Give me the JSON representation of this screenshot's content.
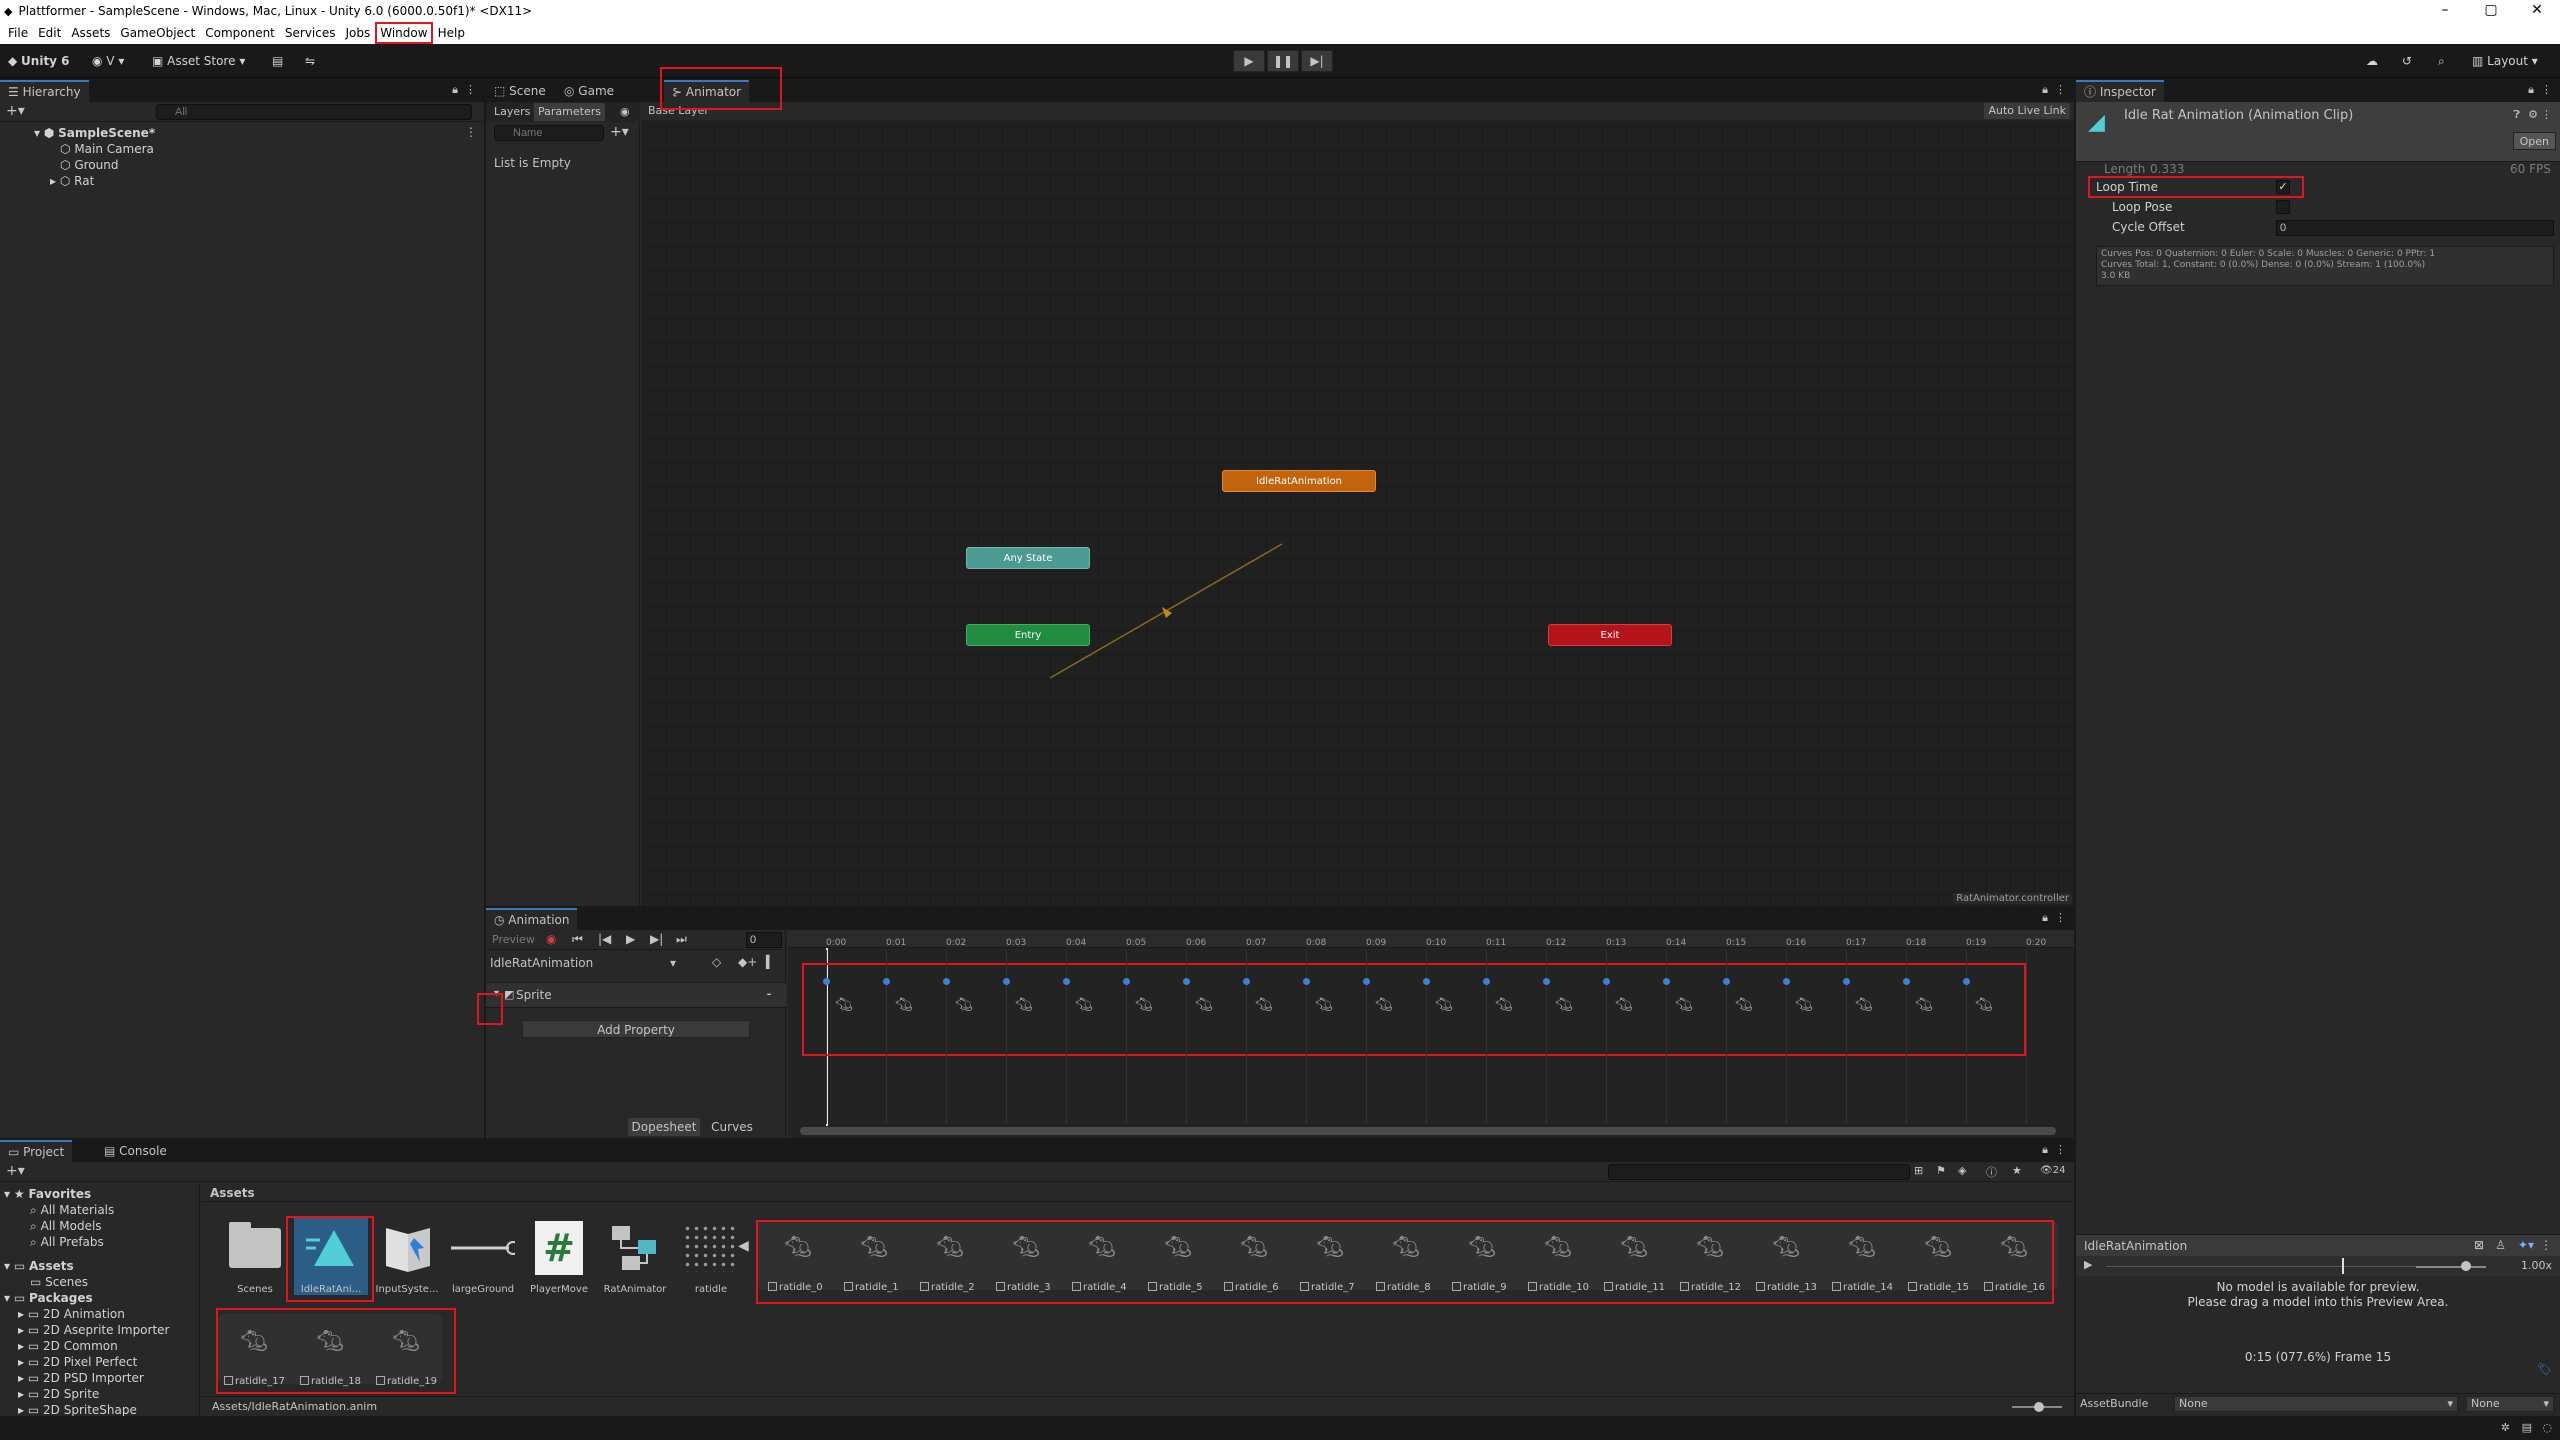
{
  "window": {
    "title": "Plattformer - SampleScene - Windows, Mac, Linux - Unity 6.0 (6000.0.50f1)* <DX11>",
    "controls": [
      "–",
      "▢",
      "✕"
    ]
  },
  "menu": [
    "File",
    "Edit",
    "Assets",
    "GameObject",
    "Component",
    "Services",
    "Jobs",
    "Window",
    "Help"
  ],
  "toolbar": {
    "account": "Unity 6",
    "version_btn": "V",
    "asset_store": "Asset Store",
    "layout": "Layout"
  },
  "hierarchy": {
    "tab": "Hierarchy",
    "search_placeholder": "All",
    "scene": "SampleScene*",
    "items": [
      "Main Camera",
      "Ground",
      "Rat"
    ]
  },
  "animator": {
    "tabs": [
      "Scene",
      "Game",
      "Animator"
    ],
    "layers_tab": "Layers",
    "parameters_tab": "Parameters",
    "name_placeholder": "Name",
    "list_empty": "List is Empty",
    "breadcrumb": "Base Layer",
    "auto_live_link": "Auto Live Link",
    "controller": "RatAnimator.controller",
    "states": {
      "idle": "IdleRatAnimation",
      "any": "Any State",
      "entry": "Entry",
      "exit": "Exit"
    }
  },
  "animation": {
    "tab": "Animation",
    "preview": "Preview",
    "frame": "0",
    "clip": "IdleRatAnimation",
    "property": "Sprite",
    "add_property": "Add Property",
    "dopesheet": "Dopesheet",
    "curves": "Curves",
    "ticks": [
      "0:00",
      "0:01",
      "0:02",
      "0:03",
      "0:04",
      "0:05",
      "0:06",
      "0:07",
      "0:08",
      "0:09",
      "0:10",
      "0:11",
      "0:12",
      "0:13",
      "0:14",
      "0:15",
      "0:16",
      "0:17",
      "0:18",
      "0:19",
      "0:20"
    ]
  },
  "inspector": {
    "tab": "Inspector",
    "title": "Idle Rat Animation (Animation Clip)",
    "open": "Open",
    "length_label": "Length",
    "length": "0.333",
    "fps": "60 FPS",
    "loop_time": "Loop Time",
    "loop_time_check": "✓",
    "loop_pose": "Loop Pose",
    "cycle_offset": "Cycle Offset",
    "cycle_offset_value": "0",
    "info1": "Curves Pos: 0 Quaternion: 0 Euler: 0 Scale: 0 Muscles: 0 Generic: 0 PPtr: 1",
    "info2": "Curves Total: 1, Constant: 0 (0.0%) Dense: 0 (0.0%) Stream: 1 (100.0%)",
    "info3": "3.0 KB",
    "preview_clip": "IdleRatAnimation",
    "speed": "1.00x",
    "no_model_1": "No model is available for preview.",
    "no_model_2": "Please drag a model into this Preview Area.",
    "time_readout": "0:15 (077.6%) Frame 15",
    "assetbundle_label": "AssetBundle",
    "assetbundle_value": "None",
    "variant_value": "None"
  },
  "project": {
    "tabs": [
      "Project",
      "Console"
    ],
    "favorites": "Favorites",
    "favorites_items": [
      "All Materials",
      "All Models",
      "All Prefabs"
    ],
    "assets": "Assets",
    "assets_items": [
      "Scenes"
    ],
    "packages": "Packages",
    "packages_items": [
      "2D Animation",
      "2D Aseprite Importer",
      "2D Common",
      "2D Pixel Perfect",
      "2D PSD Importer",
      "2D Sprite",
      "2D SpriteShape"
    ],
    "breadcrumb": "Assets",
    "count": "24",
    "footer_path": "Assets/IdleRatAnimation.anim",
    "files": [
      "Scenes",
      "IdleRatAni...",
      "InputSyste...",
      "largeGround",
      "PlayerMove",
      "RatAnimator",
      "ratidle"
    ],
    "sprites": [
      "ratidle_0",
      "ratidle_1",
      "ratidle_2",
      "ratidle_3",
      "ratidle_4",
      "ratidle_5",
      "ratidle_6",
      "ratidle_7",
      "ratidle_8",
      "ratidle_9",
      "ratidle_10",
      "ratidle_11",
      "ratidle_12",
      "ratidle_13",
      "ratidle_14",
      "ratidle_15",
      "ratidle_16"
    ],
    "sprites_row2": [
      "ratidle_17",
      "ratidle_18",
      "ratidle_19"
    ]
  }
}
